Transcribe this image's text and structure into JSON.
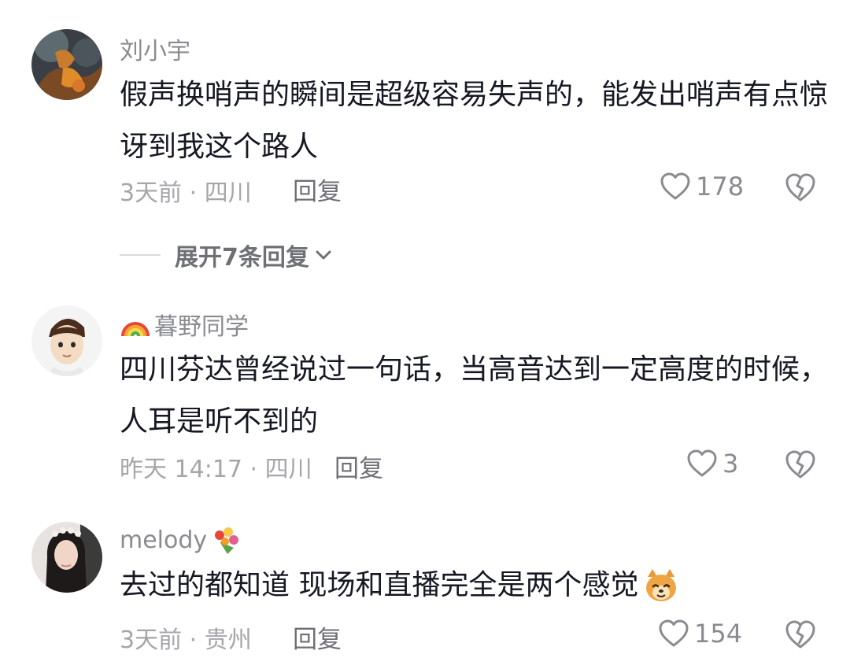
{
  "comments": [
    {
      "username": "刘小宇",
      "text": "假声换哨声的瞬间是超级容易失声的，能发出哨声有点惊讶到我这个路人",
      "meta": "3天前 · 四川",
      "reply_label": "回复",
      "likes": "178",
      "avatar_icon": "orange-figure-avatar"
    },
    {
      "username": "暮野同学",
      "username_prefix_icon": "rainbow-icon",
      "text": "四川芬达曾经说过一句话，当高音达到一定高度的时候，人耳是听不到的",
      "meta": "昨天 14:17 · 四川",
      "reply_label": "回复",
      "likes": "3",
      "avatar_icon": "cartoon-boy-avatar"
    },
    {
      "username": "melody",
      "username_suffix_icon": "bouquet-icon",
      "text": "去过的都知道 现场和直播完全是两个感觉",
      "text_suffix_icon": "dog-face-emoji",
      "meta": "3天前 · 贵州",
      "reply_label": "回复",
      "likes": "154",
      "avatar_icon": "girl-photo-avatar"
    }
  ],
  "expand_replies": {
    "label": "展开7条回复"
  },
  "colors": {
    "username": "#8a8b91",
    "text": "#161823",
    "meta": "#a5a6ab",
    "reply": "#6f7076"
  }
}
